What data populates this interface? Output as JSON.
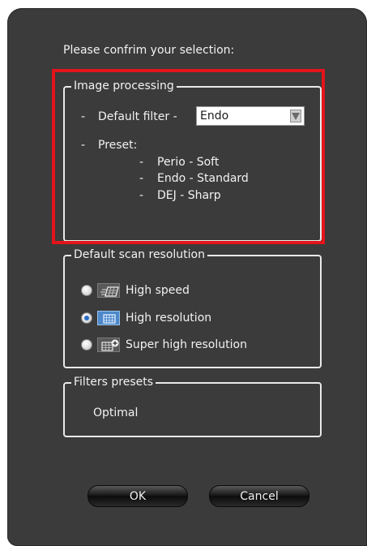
{
  "dialog": {
    "prompt": "Please confrim your selection:"
  },
  "image_processing": {
    "title": "Image processing",
    "default_filter_label": "Default filter -",
    "default_filter_value": "Endo",
    "preset_label": "Preset:",
    "presets": [
      "Perio - Soft",
      "Endo - Standard",
      "DEJ - Sharp"
    ]
  },
  "scan_resolution": {
    "title": "Default scan resolution",
    "options": [
      {
        "label": "High speed",
        "icon": "high-speed-icon",
        "selected": false
      },
      {
        "label": "High resolution",
        "icon": "high-resolution-icon",
        "selected": true
      },
      {
        "label": "Super high resolution",
        "icon": "super-high-resolution-icon",
        "selected": false
      }
    ]
  },
  "filters_presets": {
    "title": "Filters presets",
    "value": "Optimal"
  },
  "buttons": {
    "ok": "OK",
    "cancel": "Cancel"
  },
  "colors": {
    "highlight": "#e3141b",
    "dialog_bg": "#3b3b3b"
  }
}
